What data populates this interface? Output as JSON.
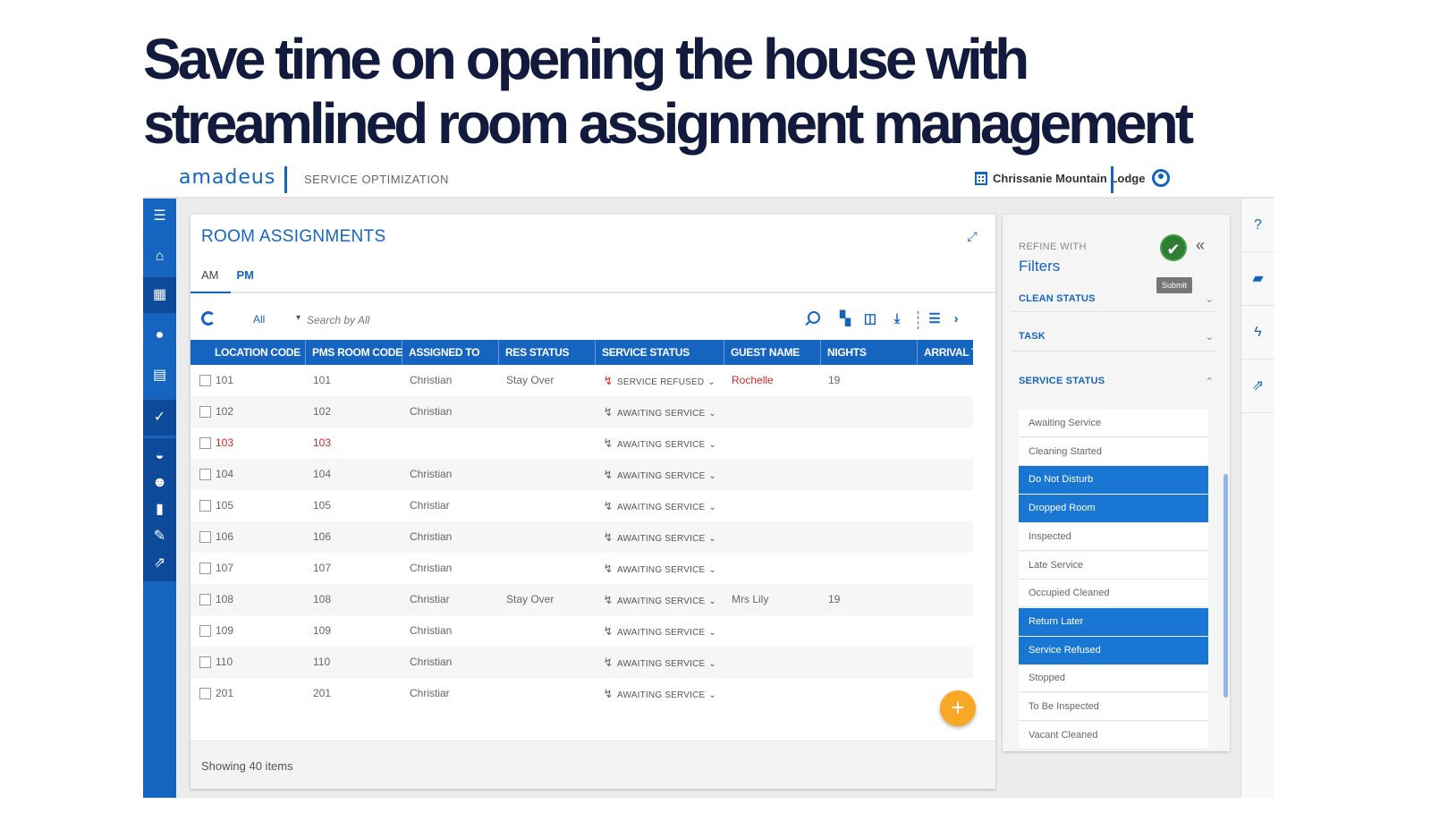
{
  "headline": "Save time on opening the house with streamlined room assignment management",
  "topbar": {
    "logo": "amadeus",
    "app_name": "SERVICE OPTIMIZATION",
    "property": "Chrissanie Mountain Lodge"
  },
  "panel": {
    "title": "ROOM ASSIGNMENTS",
    "tabs": [
      "AM",
      "PM"
    ],
    "active_tab": "PM",
    "filter_select": "All",
    "search_placeholder": "Search by All",
    "columns": [
      "LOCATION CODE",
      "PMS ROOM CODE",
      "ASSIGNED TO",
      "RES STATUS",
      "SERVICE STATUS",
      "GUEST NAME",
      "NIGHTS",
      "ARRIVAL TI"
    ],
    "rows": [
      {
        "location": "101",
        "pms": "101",
        "assigned": "Christian",
        "res": "Stay Over",
        "service": "SERVICE REFUSED",
        "guest": "Rochelle",
        "nights": "19",
        "flag": "refused"
      },
      {
        "location": "102",
        "pms": "102",
        "assigned": "Christian",
        "res": "",
        "service": "AWAITING SERVICE",
        "guest": "",
        "nights": ""
      },
      {
        "location": "103",
        "pms": "103",
        "assigned": "",
        "res": "",
        "service": "AWAITING SERVICE",
        "guest": "",
        "nights": "",
        "flag": "alert"
      },
      {
        "location": "104",
        "pms": "104",
        "assigned": "Christian",
        "res": "",
        "service": "AWAITING SERVICE",
        "guest": "",
        "nights": ""
      },
      {
        "location": "105",
        "pms": "105",
        "assigned": "Christiar",
        "res": "",
        "service": "AWAITING SERVICE",
        "guest": "",
        "nights": ""
      },
      {
        "location": "106",
        "pms": "106",
        "assigned": "Christian",
        "res": "",
        "service": "AWAITING SERVICE",
        "guest": "",
        "nights": ""
      },
      {
        "location": "107",
        "pms": "107",
        "assigned": "Christian",
        "res": "",
        "service": "AWAITING SERVICE",
        "guest": "",
        "nights": ""
      },
      {
        "location": "108",
        "pms": "108",
        "assigned": "Christiar",
        "res": "Stay Over",
        "service": "AWAITING SERVICE",
        "guest": "Mrs Lily",
        "nights": "19"
      },
      {
        "location": "109",
        "pms": "109",
        "assigned": "Christian",
        "res": "",
        "service": "AWAITING SERVICE",
        "guest": "",
        "nights": ""
      },
      {
        "location": "110",
        "pms": "110",
        "assigned": "Christian",
        "res": "",
        "service": "AWAITING SERVICE",
        "guest": "",
        "nights": ""
      },
      {
        "location": "201",
        "pms": "201",
        "assigned": "Christiar",
        "res": "",
        "service": "AWAITING SERVICE",
        "guest": "",
        "nights": ""
      }
    ],
    "item_count": "Showing 40 items",
    "fab_label": "+"
  },
  "filters": {
    "refine_label": "REFINE WITH",
    "title": "Filters",
    "submit_tooltip": "Submit",
    "sections": {
      "clean_status": "CLEAN STATUS",
      "task": "TASK",
      "service_status": "SERVICE STATUS"
    },
    "service_options": [
      {
        "label": "Awaiting Service",
        "selected": false
      },
      {
        "label": "Cleaning Started",
        "selected": false
      },
      {
        "label": "Do Not Disturb",
        "selected": true
      },
      {
        "label": "Dropped Room",
        "selected": true
      },
      {
        "label": "Inspected",
        "selected": false
      },
      {
        "label": "Late Service",
        "selected": false
      },
      {
        "label": "Occupied Cleaned",
        "selected": false
      },
      {
        "label": "Return Later",
        "selected": true
      },
      {
        "label": "Service Refused",
        "selected": true
      },
      {
        "label": "Stopped",
        "selected": false
      },
      {
        "label": "To Be Inspected",
        "selected": false
      },
      {
        "label": "Vacant Cleaned",
        "selected": false
      }
    ]
  },
  "colors": {
    "brand": "#1565c0",
    "selected": "#1976d2",
    "fab": "#f9a825",
    "alert": "#c62828",
    "submit": "#2e7d32"
  }
}
